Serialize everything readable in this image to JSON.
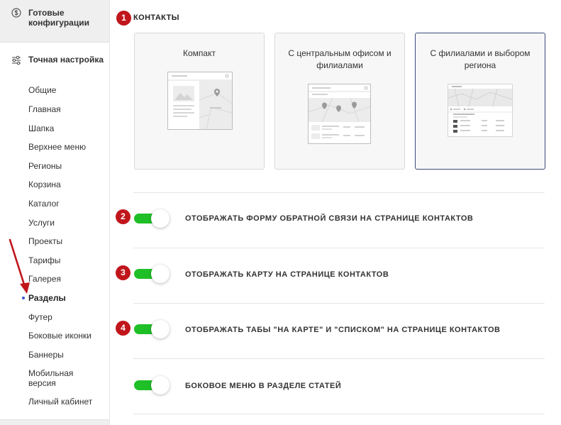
{
  "sidebar": {
    "top_item": {
      "label": "Готовые конфигурации",
      "icon": "dollar-circle-icon"
    },
    "section": {
      "label": "Точная настройка",
      "icon": "sliders-icon"
    },
    "items": [
      {
        "label": "Общие"
      },
      {
        "label": "Главная"
      },
      {
        "label": "Шапка"
      },
      {
        "label": "Верхнее меню"
      },
      {
        "label": "Регионы"
      },
      {
        "label": "Корзина"
      },
      {
        "label": "Каталог"
      },
      {
        "label": "Услуги"
      },
      {
        "label": "Проекты"
      },
      {
        "label": "Тарифы"
      },
      {
        "label": "Галерея"
      },
      {
        "label": "Разделы",
        "active": true
      },
      {
        "label": "Футер"
      },
      {
        "label": "Боковые иконки"
      },
      {
        "label": "Баннеры"
      },
      {
        "label": "Мобильная версия"
      },
      {
        "label": "Личный кабинет"
      }
    ]
  },
  "main": {
    "contacts": {
      "badge": "1",
      "title": "КОНТАКТЫ",
      "cards": [
        {
          "title": "Компакт",
          "selected": false
        },
        {
          "title": "С центральным офисом и филиалами",
          "selected": false
        },
        {
          "title": "С филиалами и выбором региона",
          "selected": true
        }
      ]
    },
    "options": [
      {
        "badge": "2",
        "label": "ОТОБРАЖАТЬ ФОРМУ ОБРАТНОЙ СВЯЗИ НА СТРАНИЦЕ КОНТАКТОВ",
        "enabled": true
      },
      {
        "badge": "3",
        "label": "ОТОБРАЖАТЬ КАРТУ НА СТРАНИЦЕ КОНТАКТОВ",
        "enabled": true
      },
      {
        "badge": "4",
        "label": "ОТОБРАЖАТЬ ТАБЫ \"НА КАРТЕ\" И \"СПИСКОМ\" НА СТРАНИЦЕ КОНТАКТОВ",
        "enabled": true
      },
      {
        "badge": "",
        "label": "БОКОВОЕ МЕНЮ В РАЗДЕЛЕ СТАТЕЙ",
        "enabled": true
      }
    ]
  },
  "colors": {
    "badge": "#c0161b",
    "toggle_on": "#1fbf27",
    "active_dot": "#3a5bd6",
    "selected_card_border": "#3b4a7a",
    "arrow": "#c0161b"
  }
}
